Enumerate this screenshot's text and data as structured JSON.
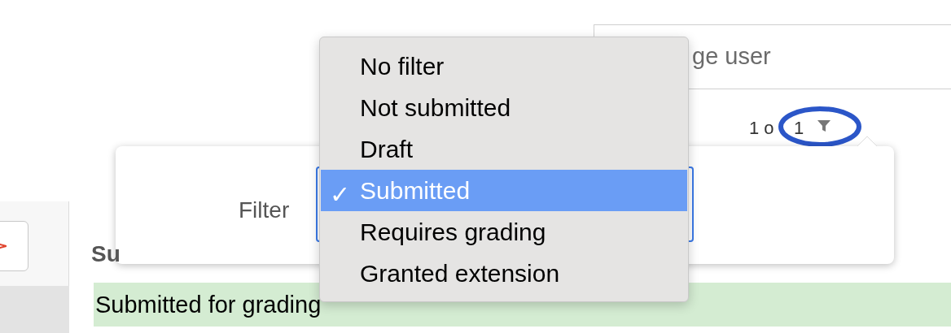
{
  "search": {
    "value": "ge user"
  },
  "counter": {
    "before": "1 o",
    "after": "1"
  },
  "section": {
    "heading": "Su",
    "status": "Submitted for grading"
  },
  "filter_popover": {
    "label": "Filter",
    "options": [
      {
        "label": "No filter",
        "selected": false
      },
      {
        "label": "Not submitted",
        "selected": false
      },
      {
        "label": "Draft",
        "selected": false
      },
      {
        "label": "Submitted",
        "selected": true,
        "check": "✓"
      },
      {
        "label": "Requires grading",
        "selected": false
      },
      {
        "label": "Granted extension",
        "selected": false
      }
    ]
  }
}
